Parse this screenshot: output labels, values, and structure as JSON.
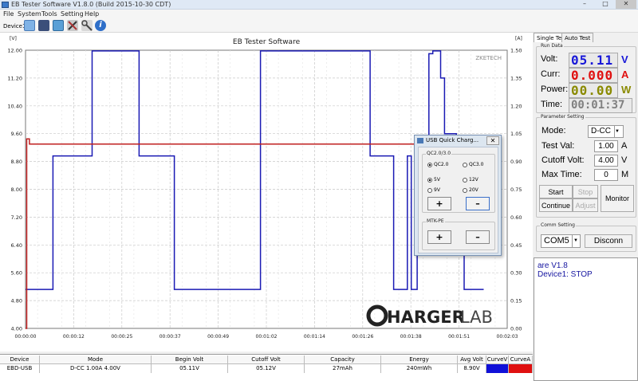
{
  "window": {
    "title": "EB Tester Software V1.8.0 (Build 2015-10-30 CDT)",
    "min": "–",
    "max": "□",
    "close": "✕"
  },
  "menu": [
    "File",
    "System",
    "Tools",
    "Setting",
    "Help"
  ],
  "toolbar": {
    "device_label": "Device1"
  },
  "chart": {
    "title": "EB Tester Software",
    "left_unit": "[V]",
    "right_unit": "[A]",
    "watermark": "ZKETECH",
    "logo_prefix": "HARGER",
    "logo_suffix": "LAB"
  },
  "chart_data": {
    "type": "line",
    "title": "EB Tester Software",
    "ylabel": "[V]",
    "y2label": "[A]",
    "ylim": [
      4.0,
      12.0
    ],
    "y2lim": [
      0,
      1.5
    ],
    "y_ticks": [
      "12.00",
      "11.20",
      "10.40",
      "9.60",
      "8.80",
      "8.00",
      "7.20",
      "6.40",
      "5.60",
      "4.80",
      "4.00"
    ],
    "y2_ticks": [
      "1.50",
      "1.35",
      "1.20",
      "1.05",
      "0.90",
      "0.75",
      "0.60",
      "0.45",
      "0.30",
      "0.15",
      "0.00"
    ],
    "x_ticks": [
      "00:00:00",
      "00:00:12",
      "00:00:25",
      "00:00:37",
      "00:00:49",
      "00:01:02",
      "00:01:14",
      "00:01:26",
      "00:01:38",
      "00:01:51",
      "00:02:03"
    ],
    "xlim_s": [
      0,
      123
    ],
    "grid": true,
    "series": [
      {
        "color": "#1a1ab4",
        "axis": "left",
        "points": [
          [
            0,
            5.12
          ],
          [
            7,
            5.12
          ],
          [
            7,
            8.96
          ],
          [
            17,
            8.96
          ],
          [
            17,
            11.98
          ],
          [
            29,
            11.98
          ],
          [
            29,
            8.96
          ],
          [
            38,
            8.96
          ],
          [
            38,
            5.12
          ],
          [
            60,
            5.12
          ],
          [
            60,
            11.98
          ],
          [
            88,
            11.98
          ],
          [
            88,
            8.96
          ],
          [
            94,
            8.96
          ],
          [
            94,
            5.12
          ],
          [
            97.5,
            5.12
          ],
          [
            97.5,
            8.96
          ],
          [
            98.5,
            8.96
          ],
          [
            98.5,
            5.12
          ],
          [
            100,
            5.12
          ],
          [
            100,
            7.3
          ],
          [
            101,
            7.3
          ],
          [
            101,
            8.96
          ],
          [
            103,
            8.96
          ],
          [
            103,
            11.9
          ],
          [
            104,
            11.9
          ],
          [
            104,
            11.98
          ],
          [
            106,
            11.98
          ],
          [
            106,
            11.2
          ],
          [
            107,
            11.2
          ],
          [
            107,
            9.6
          ],
          [
            110,
            9.6
          ],
          [
            110,
            8.96
          ],
          [
            112,
            8.96
          ],
          [
            112,
            5.12
          ],
          [
            117,
            5.12
          ]
        ]
      },
      {
        "color": "#c02020",
        "axis": "left",
        "points": [
          [
            0,
            4.0
          ],
          [
            0.3,
            4.0
          ],
          [
            0.3,
            9.45
          ],
          [
            1,
            9.45
          ],
          [
            1,
            9.3
          ],
          [
            117,
            9.3
          ]
        ]
      }
    ]
  },
  "bottom_table": {
    "headers": [
      "Device",
      "Mode",
      "Begin Volt",
      "Cutoff Volt",
      "Capacity",
      "Energy",
      "Avg Volt",
      "CurveV",
      "CurveA"
    ],
    "row": [
      "EBD-USB",
      "D-CC 1.00A 4.00V",
      "05.11V",
      "05.12V",
      "27mAh",
      "240mWh",
      "8.90V",
      "",
      ""
    ],
    "curve_v_color": "#1010d8",
    "curve_a_color": "#e01010"
  },
  "right": {
    "tabs": [
      "Single Test",
      "Auto Test"
    ],
    "run_data": {
      "title": "Run Data",
      "volt_label": "Volt:",
      "volt": "05.11",
      "volt_unit": "V",
      "curr_label": "Curr:",
      "curr": "0.000",
      "curr_unit": "A",
      "power_label": "Power:",
      "power": "00.00",
      "power_unit": "W",
      "time_label": "Time:",
      "time": "00:01:37"
    },
    "params": {
      "title": "Parameter Setting",
      "mode_label": "Mode:",
      "mode": "D-CC",
      "test_label": "Test Val:",
      "test_val": "1.00",
      "test_unit": "A",
      "cutoff_label": "Cutoff Volt:",
      "cutoff": "4.00",
      "cutoff_unit": "V",
      "max_label": "Max Time:",
      "max": "0",
      "max_unit": "M"
    },
    "buttons": {
      "start": "Start",
      "stop": "Stop",
      "continue": "Continue",
      "adjust": "Adjust",
      "monitor": "Monitor"
    },
    "comm": {
      "title": "Comm Setting",
      "port": "COM5",
      "disconnect": "Disconn"
    },
    "log": [
      "are V1.8",
      "Device1: STOP"
    ]
  },
  "dialog": {
    "title": "USB Quick Charg...",
    "group1": "QC2.0/3.0",
    "qc20": "QC2.0",
    "qc30": "QC3.0",
    "v5": "5V",
    "v12": "12V",
    "v9": "9V",
    "v20": "20V",
    "plus": "+",
    "minus": "–",
    "group2": "MTK-PE",
    "close": "✕"
  }
}
